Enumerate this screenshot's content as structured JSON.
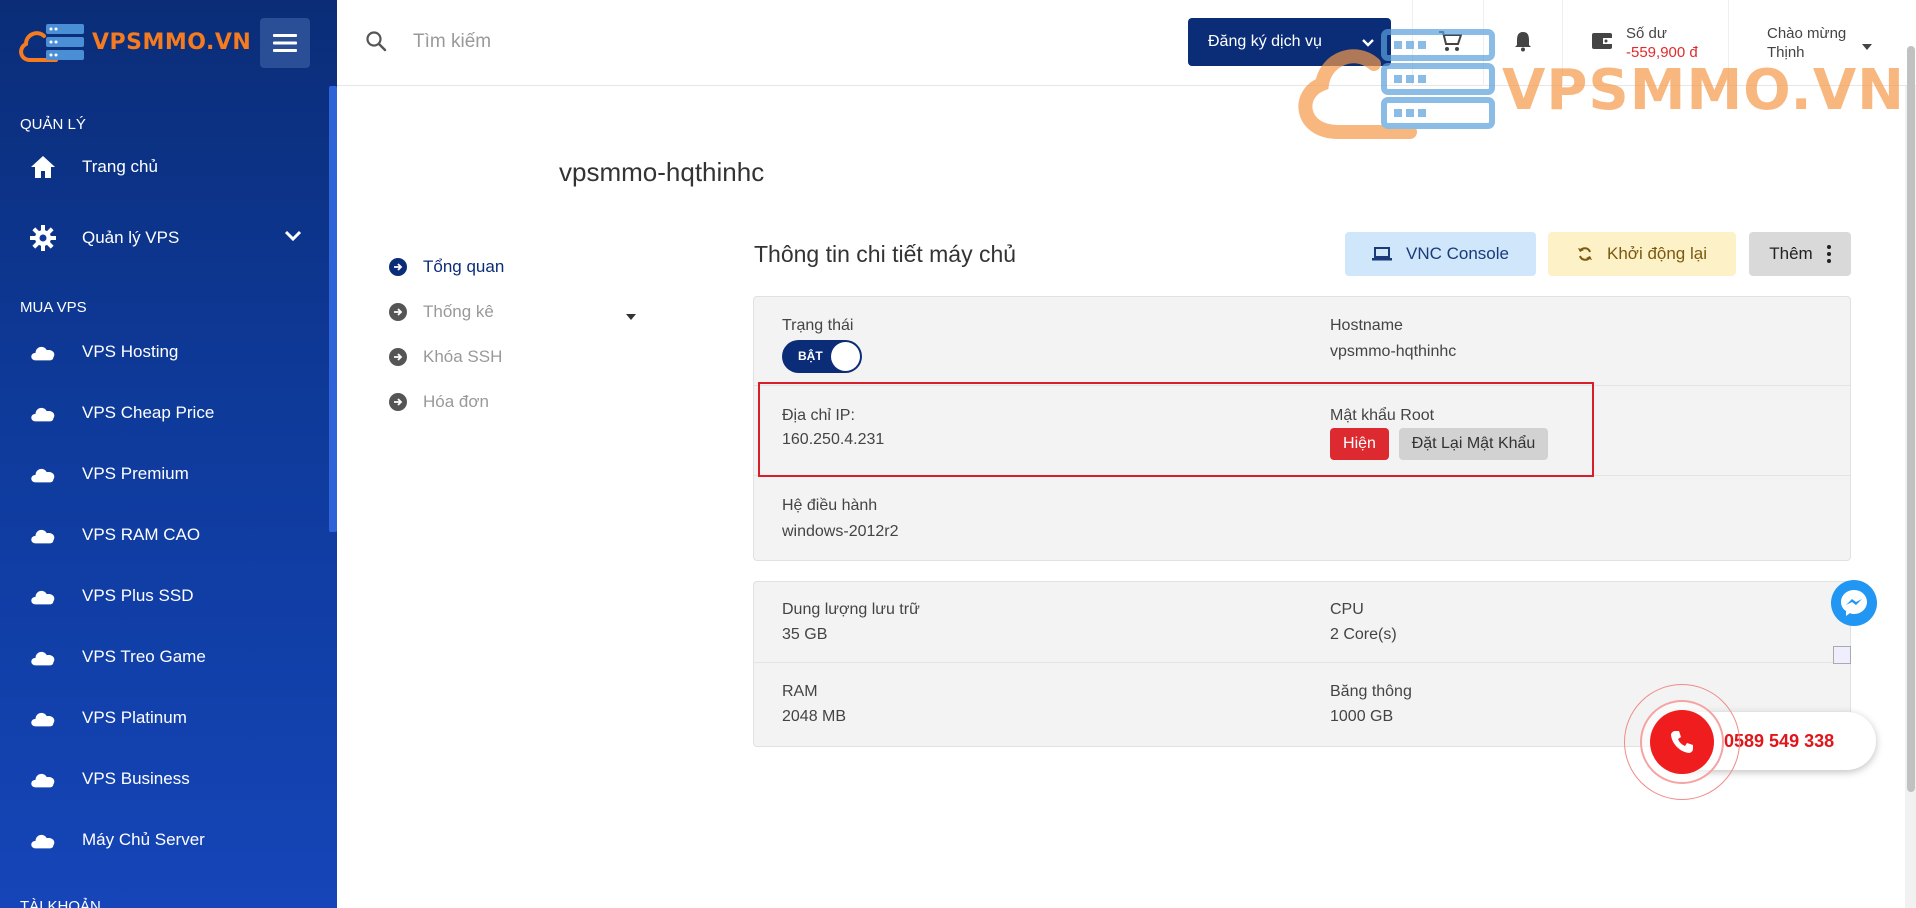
{
  "brand": {
    "name": "VPSMMO.VN",
    "color": "#f47b20"
  },
  "sidebar": {
    "sections": [
      {
        "label": "QUẢN LÝ"
      },
      {
        "label": "MUA VPS"
      },
      {
        "label": "TÀI KHOẢN"
      }
    ],
    "items": [
      {
        "label": "Trang chủ",
        "icon": "home-icon"
      },
      {
        "label": "Quản lý VPS",
        "icon": "gear-icon"
      },
      {
        "label": "VPS Hosting",
        "icon": "cloud-icon"
      },
      {
        "label": "VPS Cheap Price",
        "icon": "cloud-icon"
      },
      {
        "label": "VPS Premium",
        "icon": "cloud-icon"
      },
      {
        "label": "VPS RAM CAO",
        "icon": "cloud-icon"
      },
      {
        "label": "VPS Plus SSD",
        "icon": "cloud-icon"
      },
      {
        "label": "VPS Treo Game",
        "icon": "cloud-icon"
      },
      {
        "label": "VPS Platinum",
        "icon": "cloud-icon"
      },
      {
        "label": "VPS Business",
        "icon": "cloud-icon"
      },
      {
        "label": "Máy Chủ Server",
        "icon": "cloud-icon"
      }
    ]
  },
  "topbar": {
    "search_placeholder": "Tìm kiếm",
    "register_label": "Đăng ký dịch vụ",
    "balance_label": "Số dư",
    "balance_value": "-559,900 đ",
    "greeting_line1": "Chào mừng",
    "greeting_line2": "Thịnh"
  },
  "main": {
    "vps_name": "vpsmmo-hqthinhc",
    "subnav": [
      {
        "label": "Tổng quan",
        "active": true
      },
      {
        "label": "Thống kê",
        "active": false
      },
      {
        "label": "Khóa SSH",
        "active": false
      },
      {
        "label": "Hóa đơn",
        "active": false
      }
    ],
    "detail_title": "Thông tin chi tiết máy chủ",
    "buttons": {
      "vnc": "VNC Console",
      "restart": "Khởi động lại",
      "more": "Thêm"
    },
    "details": {
      "status_label": "Trạng thái",
      "status_toggle": "BẬT",
      "hostname_label": "Hostname",
      "hostname_value": "vpsmmo-hqthinhc",
      "ip_label": "Địa chỉ IP:",
      "ip_value": "160.250.4.231",
      "root_label": "Mật khẩu Root",
      "show_btn": "Hiện",
      "reset_btn": "Đặt Lại Mật Khẩu",
      "os_label": "Hệ điều hành",
      "os_value": "windows-2012r2"
    },
    "specs": {
      "storage_label": "Dung lượng lưu trữ",
      "storage_value": "35 GB",
      "cpu_label": "CPU",
      "cpu_value": "2 Core(s)",
      "ram_label": "RAM",
      "ram_value": "2048 MB",
      "bandwidth_label": "Băng thông",
      "bandwidth_value": "1000 GB"
    }
  },
  "contact": {
    "phone": "0589 549 338"
  },
  "colors": {
    "sidebar_dark": "#0b2d78",
    "accent_red": "#dc2a30",
    "vnc_bg": "#cfe6fb",
    "restart_bg": "#fdf1c8"
  }
}
